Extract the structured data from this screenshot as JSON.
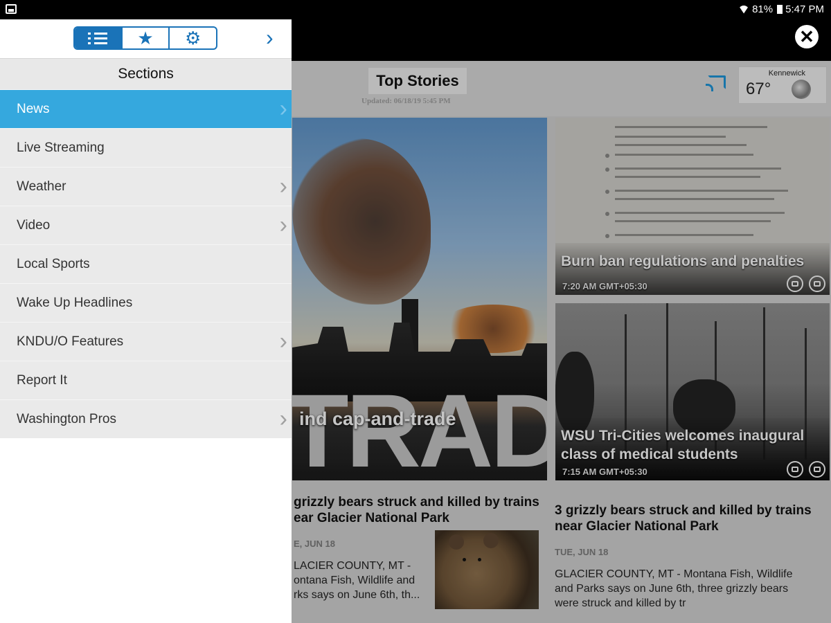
{
  "status_bar": {
    "battery": "81%",
    "time": "5:47 PM"
  },
  "drawer": {
    "tabs": [
      {
        "icon": "list-icon"
      },
      {
        "icon": "star-icon"
      },
      {
        "icon": "gear-icon"
      }
    ],
    "sections_title": "Sections",
    "items": [
      {
        "label": "News",
        "has_arrow": true,
        "selected": true
      },
      {
        "label": "Live Streaming",
        "has_arrow": false
      },
      {
        "label": "Weather",
        "has_arrow": true
      },
      {
        "label": "Video",
        "has_arrow": true
      },
      {
        "label": "Local Sports",
        "has_arrow": false
      },
      {
        "label": "Wake Up Headlines",
        "has_arrow": false
      },
      {
        "label": "KNDU/O Features",
        "has_arrow": true
      },
      {
        "label": "Report It",
        "has_arrow": false
      },
      {
        "label": "Washington Pros",
        "has_arrow": true
      }
    ],
    "accent": "#35a8de"
  },
  "header": {
    "title": "Top Stories",
    "updated": "Updated: 06/18/19 5:45 PM",
    "weather": {
      "city": "Kennewick",
      "temp": "67°"
    }
  },
  "cards": {
    "cap_trade": {
      "caption": "ind cap-and-trade",
      "overlay_word": "TRADE"
    },
    "burn_ban": {
      "title": "Burn ban regulations and penalties",
      "time": "7:20 AM GMT+05:30"
    },
    "wsu": {
      "title_line1": "WSU Tri-Cities welcomes inaugural",
      "title_line2": "class of medical students",
      "time": "7:15 AM GMT+05:30"
    }
  },
  "articles": {
    "left": {
      "title_line1": "grizzly bears struck and killed by trains",
      "title_line2": "ear Glacier National Park",
      "date": "E, JUN 18",
      "text_line1": "LACIER COUNTY, MT -",
      "text_line2": "ontana Fish, Wildlife and",
      "text_line3": "rks says on June 6th, th..."
    },
    "right": {
      "title_line1": "3 grizzly bears struck and killed by trains",
      "title_line2": "near Glacier National Park",
      "date": "TUE, JUN 18",
      "text_line1": "GLACIER COUNTY, MT - Montana Fish, Wildlife",
      "text_line2": "and Parks says on June 6th, three grizzly bears",
      "text_line3": "were struck and killed by tr"
    }
  }
}
